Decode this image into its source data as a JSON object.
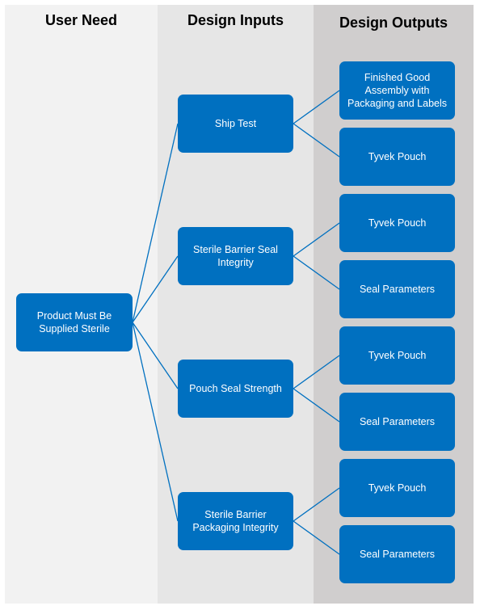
{
  "columns": {
    "user_need": "User Need",
    "design_inputs": "Design Inputs",
    "design_outputs": "Design Outputs"
  },
  "colors": {
    "box": "#0070c0",
    "line": "#0070c0",
    "col1": "#f2f2f2",
    "col2": "#e6e6e6",
    "col3": "#d0cece"
  },
  "user_need": "Product Must Be Supplied Sterile",
  "inputs": [
    {
      "label": "Ship Test",
      "outputs": [
        "Finished Good Assembly with Packaging and Labels",
        "Tyvek Pouch"
      ]
    },
    {
      "label": "Sterile Barrier Seal Integrity",
      "outputs": [
        "Tyvek Pouch",
        "Seal Parameters"
      ]
    },
    {
      "label": "Pouch Seal Strength",
      "outputs": [
        "Tyvek Pouch",
        "Seal Parameters"
      ]
    },
    {
      "label": "Sterile Barrier Packaging Integrity",
      "outputs": [
        "Tyvek Pouch",
        "Seal Parameters"
      ]
    }
  ]
}
